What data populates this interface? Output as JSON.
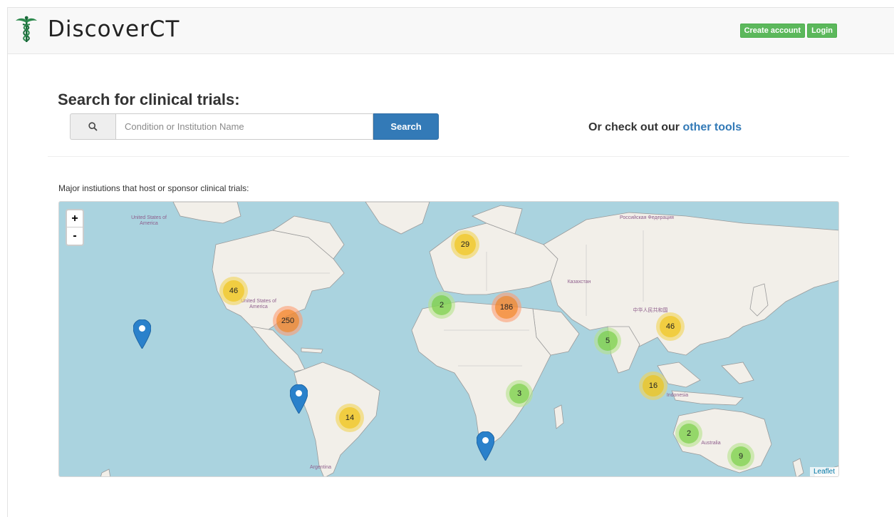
{
  "header": {
    "brand_name": "DiscoverCT",
    "logo_icon": "caduceus-icon",
    "create_account_label": "Create account",
    "login_label": "Login"
  },
  "search": {
    "title": "Search for clinical trials:",
    "icon": "search-icon",
    "placeholder": "Condition or Institution Name",
    "button_label": "Search",
    "other_prefix": "Or check out our",
    "other_link": "other tools"
  },
  "map": {
    "caption": "Major instiutions that host or sponsor clinical trials:",
    "zoom_in": "+",
    "zoom_out": "-",
    "attribution": "Leaflet",
    "country_labels": [
      "United States of America",
      "United States of America",
      "Российская Федерация",
      "Казахстан",
      "中华人民共和国",
      "Indonesia",
      "Australia",
      "Argentina"
    ],
    "clusters": [
      {
        "count": "29",
        "size": "medium"
      },
      {
        "count": "46",
        "size": "medium"
      },
      {
        "count": "250",
        "size": "large"
      },
      {
        "count": "2",
        "size": "small"
      },
      {
        "count": "186",
        "size": "large"
      },
      {
        "count": "5",
        "size": "small"
      },
      {
        "count": "46",
        "size": "medium"
      },
      {
        "count": "16",
        "size": "medium"
      },
      {
        "count": "3",
        "size": "small"
      },
      {
        "count": "14",
        "size": "medium"
      },
      {
        "count": "2",
        "size": "small"
      },
      {
        "count": "9",
        "size": "small"
      }
    ],
    "marker_icon": "map-marker-icon",
    "colors": {
      "water": "#aad3df",
      "land": "#f2efe9",
      "link": "#337ab7",
      "button_green": "#5cb85c"
    }
  }
}
